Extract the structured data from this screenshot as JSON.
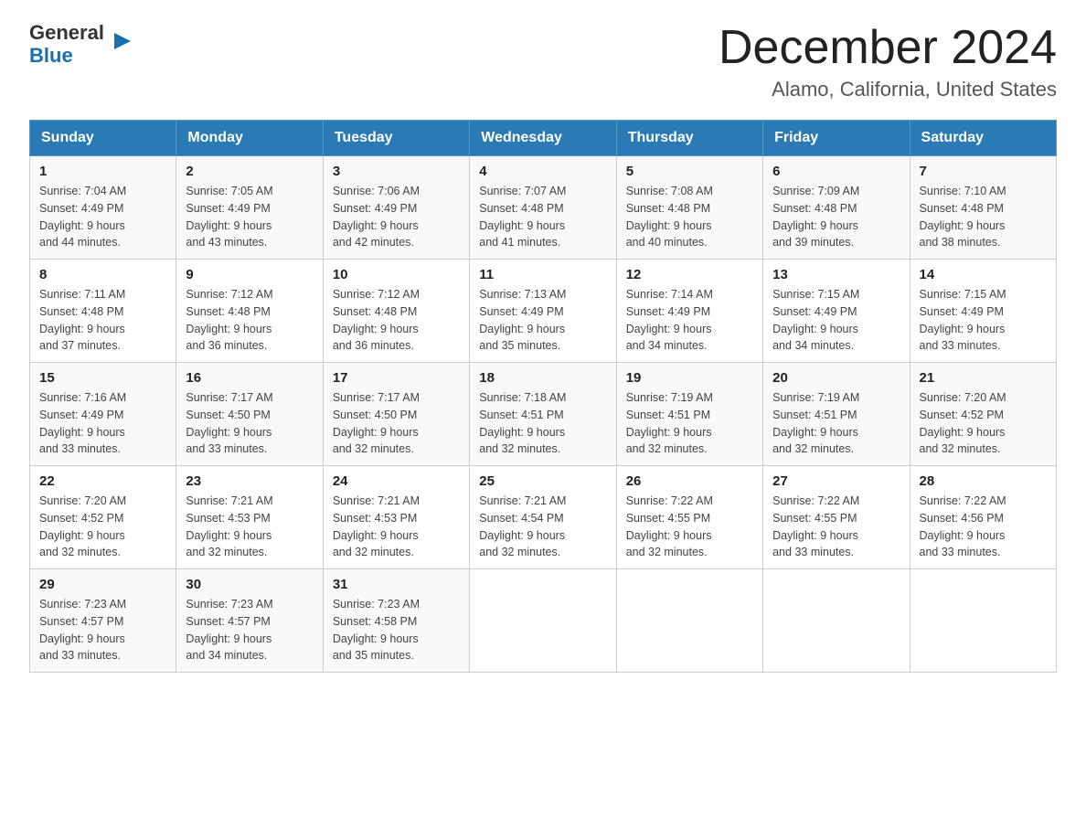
{
  "header": {
    "logo_line1": "General",
    "logo_line2": "Blue",
    "month_title": "December 2024",
    "location": "Alamo, California, United States"
  },
  "days_of_week": [
    "Sunday",
    "Monday",
    "Tuesday",
    "Wednesday",
    "Thursday",
    "Friday",
    "Saturday"
  ],
  "weeks": [
    [
      {
        "day": "1",
        "sunrise": "7:04 AM",
        "sunset": "4:49 PM",
        "daylight": "9 hours and 44 minutes."
      },
      {
        "day": "2",
        "sunrise": "7:05 AM",
        "sunset": "4:49 PM",
        "daylight": "9 hours and 43 minutes."
      },
      {
        "day": "3",
        "sunrise": "7:06 AM",
        "sunset": "4:49 PM",
        "daylight": "9 hours and 42 minutes."
      },
      {
        "day": "4",
        "sunrise": "7:07 AM",
        "sunset": "4:48 PM",
        "daylight": "9 hours and 41 minutes."
      },
      {
        "day": "5",
        "sunrise": "7:08 AM",
        "sunset": "4:48 PM",
        "daylight": "9 hours and 40 minutes."
      },
      {
        "day": "6",
        "sunrise": "7:09 AM",
        "sunset": "4:48 PM",
        "daylight": "9 hours and 39 minutes."
      },
      {
        "day": "7",
        "sunrise": "7:10 AM",
        "sunset": "4:48 PM",
        "daylight": "9 hours and 38 minutes."
      }
    ],
    [
      {
        "day": "8",
        "sunrise": "7:11 AM",
        "sunset": "4:48 PM",
        "daylight": "9 hours and 37 minutes."
      },
      {
        "day": "9",
        "sunrise": "7:12 AM",
        "sunset": "4:48 PM",
        "daylight": "9 hours and 36 minutes."
      },
      {
        "day": "10",
        "sunrise": "7:12 AM",
        "sunset": "4:48 PM",
        "daylight": "9 hours and 36 minutes."
      },
      {
        "day": "11",
        "sunrise": "7:13 AM",
        "sunset": "4:49 PM",
        "daylight": "9 hours and 35 minutes."
      },
      {
        "day": "12",
        "sunrise": "7:14 AM",
        "sunset": "4:49 PM",
        "daylight": "9 hours and 34 minutes."
      },
      {
        "day": "13",
        "sunrise": "7:15 AM",
        "sunset": "4:49 PM",
        "daylight": "9 hours and 34 minutes."
      },
      {
        "day": "14",
        "sunrise": "7:15 AM",
        "sunset": "4:49 PM",
        "daylight": "9 hours and 33 minutes."
      }
    ],
    [
      {
        "day": "15",
        "sunrise": "7:16 AM",
        "sunset": "4:49 PM",
        "daylight": "9 hours and 33 minutes."
      },
      {
        "day": "16",
        "sunrise": "7:17 AM",
        "sunset": "4:50 PM",
        "daylight": "9 hours and 33 minutes."
      },
      {
        "day": "17",
        "sunrise": "7:17 AM",
        "sunset": "4:50 PM",
        "daylight": "9 hours and 32 minutes."
      },
      {
        "day": "18",
        "sunrise": "7:18 AM",
        "sunset": "4:51 PM",
        "daylight": "9 hours and 32 minutes."
      },
      {
        "day": "19",
        "sunrise": "7:19 AM",
        "sunset": "4:51 PM",
        "daylight": "9 hours and 32 minutes."
      },
      {
        "day": "20",
        "sunrise": "7:19 AM",
        "sunset": "4:51 PM",
        "daylight": "9 hours and 32 minutes."
      },
      {
        "day": "21",
        "sunrise": "7:20 AM",
        "sunset": "4:52 PM",
        "daylight": "9 hours and 32 minutes."
      }
    ],
    [
      {
        "day": "22",
        "sunrise": "7:20 AM",
        "sunset": "4:52 PM",
        "daylight": "9 hours and 32 minutes."
      },
      {
        "day": "23",
        "sunrise": "7:21 AM",
        "sunset": "4:53 PM",
        "daylight": "9 hours and 32 minutes."
      },
      {
        "day": "24",
        "sunrise": "7:21 AM",
        "sunset": "4:53 PM",
        "daylight": "9 hours and 32 minutes."
      },
      {
        "day": "25",
        "sunrise": "7:21 AM",
        "sunset": "4:54 PM",
        "daylight": "9 hours and 32 minutes."
      },
      {
        "day": "26",
        "sunrise": "7:22 AM",
        "sunset": "4:55 PM",
        "daylight": "9 hours and 32 minutes."
      },
      {
        "day": "27",
        "sunrise": "7:22 AM",
        "sunset": "4:55 PM",
        "daylight": "9 hours and 33 minutes."
      },
      {
        "day": "28",
        "sunrise": "7:22 AM",
        "sunset": "4:56 PM",
        "daylight": "9 hours and 33 minutes."
      }
    ],
    [
      {
        "day": "29",
        "sunrise": "7:23 AM",
        "sunset": "4:57 PM",
        "daylight": "9 hours and 33 minutes."
      },
      {
        "day": "30",
        "sunrise": "7:23 AM",
        "sunset": "4:57 PM",
        "daylight": "9 hours and 34 minutes."
      },
      {
        "day": "31",
        "sunrise": "7:23 AM",
        "sunset": "4:58 PM",
        "daylight": "9 hours and 35 minutes."
      },
      null,
      null,
      null,
      null
    ]
  ],
  "labels": {
    "sunrise": "Sunrise:",
    "sunset": "Sunset:",
    "daylight": "Daylight:"
  }
}
